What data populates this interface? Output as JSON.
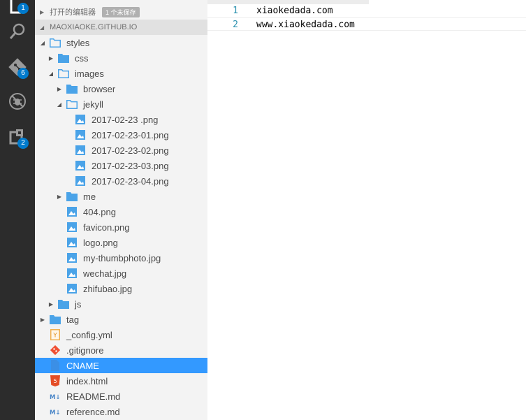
{
  "activity_bar": {
    "items": [
      {
        "name": "explorer-icon",
        "badge": "1"
      },
      {
        "name": "search-icon",
        "badge": ""
      },
      {
        "name": "git-icon",
        "badge": "6"
      },
      {
        "name": "debug-icon",
        "badge": ""
      },
      {
        "name": "extensions-icon",
        "badge": "2"
      }
    ]
  },
  "sidebar": {
    "open_editors": {
      "label": "打开的编辑器",
      "badge": "1 个未保存"
    },
    "folder": {
      "label": "MAOXIAOKE.GITHUB.IO"
    },
    "tree": [
      {
        "label": "styles",
        "type": "folder",
        "expanded": true,
        "depth": 1
      },
      {
        "label": "css",
        "type": "folder",
        "expanded": false,
        "depth": 2
      },
      {
        "label": "images",
        "type": "folder",
        "expanded": true,
        "depth": 2
      },
      {
        "label": "browser",
        "type": "folder",
        "expanded": false,
        "depth": 3
      },
      {
        "label": "jekyll",
        "type": "folder",
        "expanded": true,
        "depth": 3
      },
      {
        "label": "2017-02-23 .png",
        "type": "image",
        "depth": 4
      },
      {
        "label": "2017-02-23-01.png",
        "type": "image",
        "depth": 4
      },
      {
        "label": "2017-02-23-02.png",
        "type": "image",
        "depth": 4
      },
      {
        "label": "2017-02-23-03.png",
        "type": "image",
        "depth": 4
      },
      {
        "label": "2017-02-23-04.png",
        "type": "image",
        "depth": 4
      },
      {
        "label": "me",
        "type": "folder",
        "expanded": false,
        "depth": 3
      },
      {
        "label": "404.png",
        "type": "image",
        "depth": 3
      },
      {
        "label": "favicon.png",
        "type": "image",
        "depth": 3
      },
      {
        "label": "logo.png",
        "type": "image",
        "depth": 3
      },
      {
        "label": "my-thumbphoto.jpg",
        "type": "image",
        "depth": 3
      },
      {
        "label": "wechat.jpg",
        "type": "image",
        "depth": 3
      },
      {
        "label": "zhifubao.jpg",
        "type": "image",
        "depth": 3
      },
      {
        "label": "js",
        "type": "folder",
        "expanded": false,
        "depth": 2
      },
      {
        "label": "tag",
        "type": "folder",
        "expanded": false,
        "depth": 1
      },
      {
        "label": "_config.yml",
        "type": "yaml",
        "depth": 1
      },
      {
        "label": ".gitignore",
        "type": "git",
        "depth": 1
      },
      {
        "label": "CNAME",
        "type": "file",
        "depth": 1,
        "selected": true
      },
      {
        "label": "index.html",
        "type": "html",
        "depth": 1
      },
      {
        "label": "README.md",
        "type": "markdown",
        "depth": 1
      },
      {
        "label": "reference.md",
        "type": "markdown",
        "depth": 1
      }
    ]
  },
  "editor": {
    "lines": [
      {
        "num": "1",
        "text": "xiaokedada.com"
      },
      {
        "num": "2",
        "text": "www.xiaokedada.com"
      }
    ]
  },
  "colors": {
    "accent": "#007acc",
    "selection": "#3399ff",
    "folder": "#4aa3e8",
    "image": "#4aa3e8",
    "activity_bg": "#2c2c2c",
    "sidebar_bg": "#f3f3f3"
  }
}
